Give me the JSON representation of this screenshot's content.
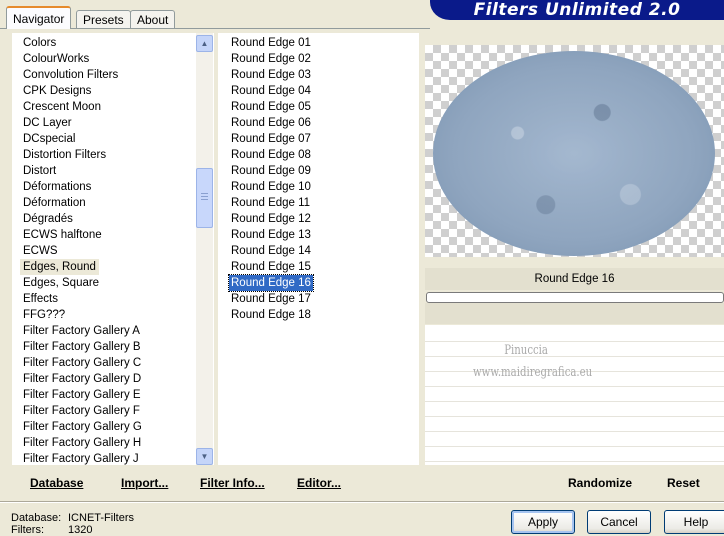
{
  "tabs": [
    "Navigator",
    "Presets",
    "About"
  ],
  "banner_title": "Filters Unlimited 2.0",
  "categories": [
    "Colors",
    "ColourWorks",
    "Convolution Filters",
    "CPK Designs",
    "Crescent Moon",
    "DC Layer",
    "DCspecial",
    "Distortion Filters",
    "Distort",
    "Déformations",
    "Déformation",
    "Dégradés",
    "ECWS halftone",
    "ECWS",
    "Edges, Round",
    "Edges, Square",
    "Effects",
    "FFG???",
    "Filter Factory Gallery A",
    "Filter Factory Gallery B",
    "Filter Factory Gallery C",
    "Filter Factory Gallery D",
    "Filter Factory Gallery E",
    "Filter Factory Gallery F",
    "Filter Factory Gallery G",
    "Filter Factory Gallery H",
    "Filter Factory Gallery J"
  ],
  "selected_category": "Edges, Round",
  "effects": [
    "Round Edge 01",
    "Round Edge 02",
    "Round Edge 03",
    "Round Edge 04",
    "Round Edge 05",
    "Round Edge 06",
    "Round Edge 07",
    "Round Edge 08",
    "Round Edge 09",
    "Round Edge 10",
    "Round Edge 11",
    "Round Edge 12",
    "Round Edge 13",
    "Round Edge 14",
    "Round Edge 15",
    "Round Edge 16",
    "Round Edge 17",
    "Round Edge 18"
  ],
  "selected_effect": "Round Edge 16",
  "preview_effect_name": "Round Edge 16",
  "watermark": {
    "line1": "Pinuccia",
    "line2": "www.maidiregrafica.eu"
  },
  "bottom_left_buttons": [
    "Database",
    "Import...",
    "Filter Info...",
    "Editor..."
  ],
  "bottom_right_buttons": [
    "Randomize",
    "Reset"
  ],
  "status": {
    "database_label": "Database:",
    "database_value": "ICNET-Filters",
    "filters_label": "Filters:",
    "filters_value": "1320"
  },
  "dialog_buttons": [
    "Apply",
    "Cancel",
    "Help"
  ],
  "icons": {
    "scroll_up": "scroll-up-arrow-icon",
    "scroll_down": "scroll-down-arrow-icon"
  },
  "colors": {
    "banner": "#0a1a8a",
    "selection": "#316ac5",
    "active_tab_accent": "#e68b2c"
  }
}
